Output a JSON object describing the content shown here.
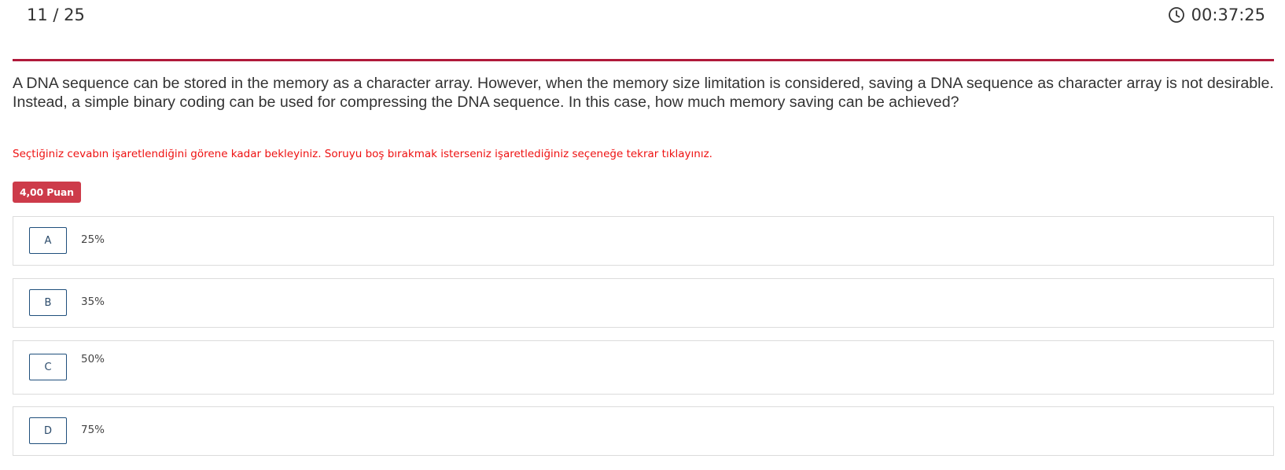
{
  "header": {
    "progress": "11 / 25",
    "timer": "00:37:25",
    "timer_icon": "clock-icon"
  },
  "question": {
    "text": "A DNA sequence can be stored in the memory as a character array. However, when the memory size limitation is considered, saving a DNA sequence as character array is not desirable. Instead, a simple binary coding can be used for compressing the DNA sequence. In this case, how much memory saving can be achieved?",
    "warning": "Seçtiğiniz cevabın işaretlendiğini görene kadar bekleyiniz. Soruyu boş bırakmak isterseniz işaretlediğiniz seçeneğe tekrar tıklayınız.",
    "points": "4,00 Puan"
  },
  "options": [
    {
      "letter": "A",
      "text": "25%"
    },
    {
      "letter": "B",
      "text": "35%"
    },
    {
      "letter": "C",
      "text": "50%"
    },
    {
      "letter": "D",
      "text": "75%"
    }
  ],
  "colors": {
    "accent": "#b0193a",
    "badge": "#cd3b4a",
    "warning": "#ee1111",
    "option_border": "#1f4f7c"
  }
}
